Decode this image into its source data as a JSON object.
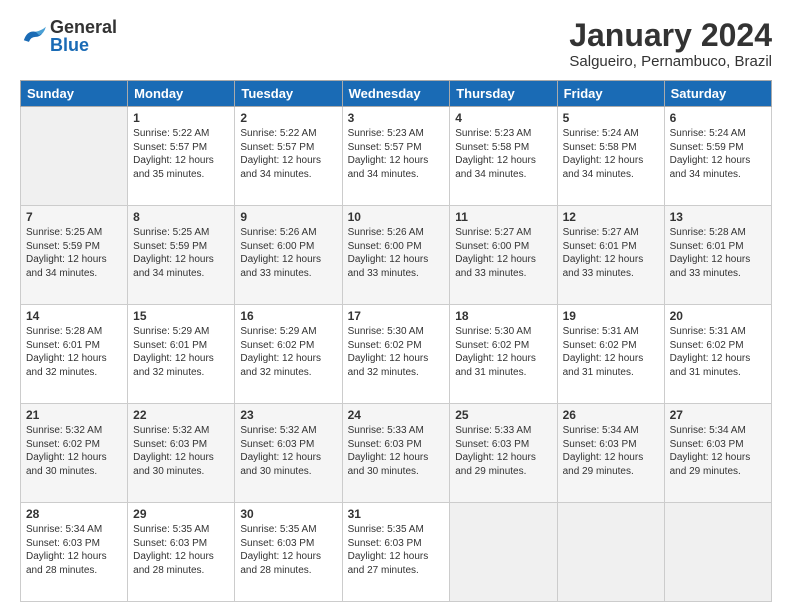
{
  "header": {
    "logo": {
      "general": "General",
      "blue": "Blue"
    },
    "title": "January 2024",
    "location": "Salgueiro, Pernambuco, Brazil"
  },
  "weekdays": [
    "Sunday",
    "Monday",
    "Tuesday",
    "Wednesday",
    "Thursday",
    "Friday",
    "Saturday"
  ],
  "weeks": [
    [
      {
        "day": "",
        "info": ""
      },
      {
        "day": "1",
        "info": "Sunrise: 5:22 AM\nSunset: 5:57 PM\nDaylight: 12 hours\nand 35 minutes."
      },
      {
        "day": "2",
        "info": "Sunrise: 5:22 AM\nSunset: 5:57 PM\nDaylight: 12 hours\nand 34 minutes."
      },
      {
        "day": "3",
        "info": "Sunrise: 5:23 AM\nSunset: 5:57 PM\nDaylight: 12 hours\nand 34 minutes."
      },
      {
        "day": "4",
        "info": "Sunrise: 5:23 AM\nSunset: 5:58 PM\nDaylight: 12 hours\nand 34 minutes."
      },
      {
        "day": "5",
        "info": "Sunrise: 5:24 AM\nSunset: 5:58 PM\nDaylight: 12 hours\nand 34 minutes."
      },
      {
        "day": "6",
        "info": "Sunrise: 5:24 AM\nSunset: 5:59 PM\nDaylight: 12 hours\nand 34 minutes."
      }
    ],
    [
      {
        "day": "7",
        "info": "Sunrise: 5:25 AM\nSunset: 5:59 PM\nDaylight: 12 hours\nand 34 minutes."
      },
      {
        "day": "8",
        "info": "Sunrise: 5:25 AM\nSunset: 5:59 PM\nDaylight: 12 hours\nand 34 minutes."
      },
      {
        "day": "9",
        "info": "Sunrise: 5:26 AM\nSunset: 6:00 PM\nDaylight: 12 hours\nand 33 minutes."
      },
      {
        "day": "10",
        "info": "Sunrise: 5:26 AM\nSunset: 6:00 PM\nDaylight: 12 hours\nand 33 minutes."
      },
      {
        "day": "11",
        "info": "Sunrise: 5:27 AM\nSunset: 6:00 PM\nDaylight: 12 hours\nand 33 minutes."
      },
      {
        "day": "12",
        "info": "Sunrise: 5:27 AM\nSunset: 6:01 PM\nDaylight: 12 hours\nand 33 minutes."
      },
      {
        "day": "13",
        "info": "Sunrise: 5:28 AM\nSunset: 6:01 PM\nDaylight: 12 hours\nand 33 minutes."
      }
    ],
    [
      {
        "day": "14",
        "info": "Sunrise: 5:28 AM\nSunset: 6:01 PM\nDaylight: 12 hours\nand 32 minutes."
      },
      {
        "day": "15",
        "info": "Sunrise: 5:29 AM\nSunset: 6:01 PM\nDaylight: 12 hours\nand 32 minutes."
      },
      {
        "day": "16",
        "info": "Sunrise: 5:29 AM\nSunset: 6:02 PM\nDaylight: 12 hours\nand 32 minutes."
      },
      {
        "day": "17",
        "info": "Sunrise: 5:30 AM\nSunset: 6:02 PM\nDaylight: 12 hours\nand 32 minutes."
      },
      {
        "day": "18",
        "info": "Sunrise: 5:30 AM\nSunset: 6:02 PM\nDaylight: 12 hours\nand 31 minutes."
      },
      {
        "day": "19",
        "info": "Sunrise: 5:31 AM\nSunset: 6:02 PM\nDaylight: 12 hours\nand 31 minutes."
      },
      {
        "day": "20",
        "info": "Sunrise: 5:31 AM\nSunset: 6:02 PM\nDaylight: 12 hours\nand 31 minutes."
      }
    ],
    [
      {
        "day": "21",
        "info": "Sunrise: 5:32 AM\nSunset: 6:02 PM\nDaylight: 12 hours\nand 30 minutes."
      },
      {
        "day": "22",
        "info": "Sunrise: 5:32 AM\nSunset: 6:03 PM\nDaylight: 12 hours\nand 30 minutes."
      },
      {
        "day": "23",
        "info": "Sunrise: 5:32 AM\nSunset: 6:03 PM\nDaylight: 12 hours\nand 30 minutes."
      },
      {
        "day": "24",
        "info": "Sunrise: 5:33 AM\nSunset: 6:03 PM\nDaylight: 12 hours\nand 30 minutes."
      },
      {
        "day": "25",
        "info": "Sunrise: 5:33 AM\nSunset: 6:03 PM\nDaylight: 12 hours\nand 29 minutes."
      },
      {
        "day": "26",
        "info": "Sunrise: 5:34 AM\nSunset: 6:03 PM\nDaylight: 12 hours\nand 29 minutes."
      },
      {
        "day": "27",
        "info": "Sunrise: 5:34 AM\nSunset: 6:03 PM\nDaylight: 12 hours\nand 29 minutes."
      }
    ],
    [
      {
        "day": "28",
        "info": "Sunrise: 5:34 AM\nSunset: 6:03 PM\nDaylight: 12 hours\nand 28 minutes."
      },
      {
        "day": "29",
        "info": "Sunrise: 5:35 AM\nSunset: 6:03 PM\nDaylight: 12 hours\nand 28 minutes."
      },
      {
        "day": "30",
        "info": "Sunrise: 5:35 AM\nSunset: 6:03 PM\nDaylight: 12 hours\nand 28 minutes."
      },
      {
        "day": "31",
        "info": "Sunrise: 5:35 AM\nSunset: 6:03 PM\nDaylight: 12 hours\nand 27 minutes."
      },
      {
        "day": "",
        "info": ""
      },
      {
        "day": "",
        "info": ""
      },
      {
        "day": "",
        "info": ""
      }
    ]
  ]
}
